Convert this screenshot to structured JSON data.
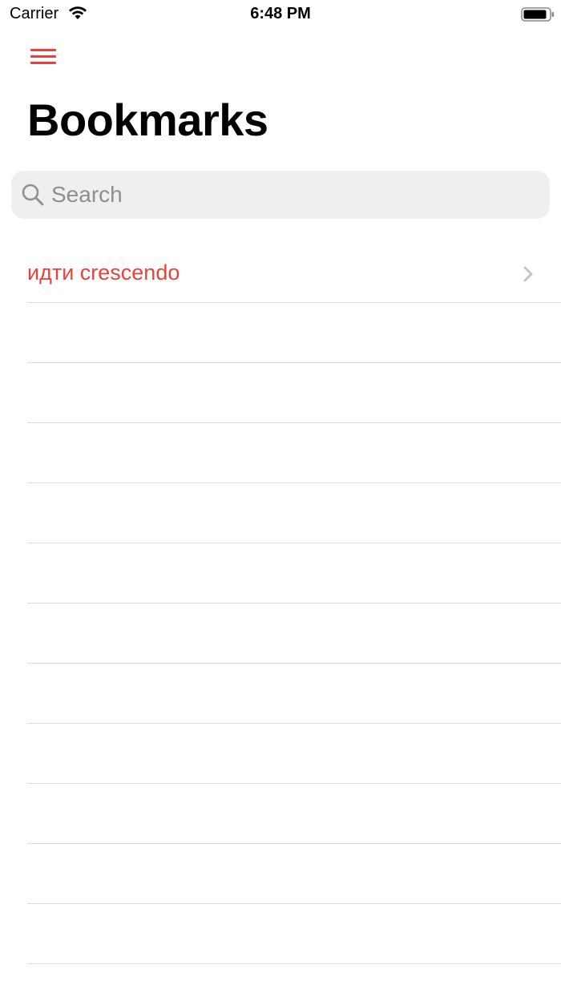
{
  "status_bar": {
    "carrier": "Carrier",
    "time": "6:48 PM"
  },
  "header": {
    "title": "Bookmarks"
  },
  "search": {
    "placeholder": "Search",
    "value": ""
  },
  "bookmarks": [
    {
      "label": "идти crescendo"
    }
  ],
  "colors": {
    "accent": "#e8433a",
    "search_bg": "#efefef",
    "separator": "#dcdcdc",
    "placeholder": "#8e8e93"
  },
  "icons": {
    "menu": "hamburger-icon",
    "search": "magnifier-icon",
    "row_disclosure": "chevron-right-icon"
  }
}
